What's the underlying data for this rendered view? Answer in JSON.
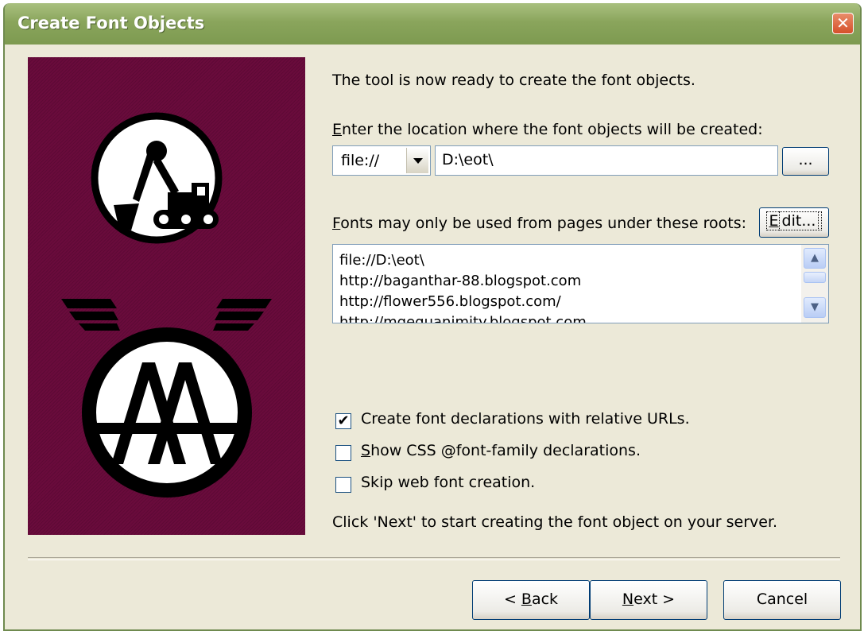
{
  "window": {
    "title": "Create Font Objects",
    "close_glyph": "✕"
  },
  "intro_text": "The tool is now ready to create the font objects.",
  "location": {
    "label_prefix": "E",
    "label_rest": "nter the location where the font objects will be created:",
    "protocol_value": "file://",
    "path_value": "D:\\eot\\",
    "browse_label": "..."
  },
  "roots": {
    "label_prefix": "F",
    "label_rest": "onts may only be used from pages under these roots:",
    "edit_prefix": "E",
    "edit_rest": "dit...",
    "items": [
      "file://D:\\eot\\",
      "http://baganthar-88.blogspot.com",
      "http://flower556.blogspot.com/",
      "http://mgequanimity.blogspot.com"
    ]
  },
  "options": [
    {
      "label": "Create font declarations with relative URLs.",
      "checked": true
    },
    {
      "label_prefix": "S",
      "label_rest": "how CSS @font-family declarations.",
      "checked": false
    },
    {
      "label": "Skip web font creation.",
      "checked": false
    }
  ],
  "hint_text": "Click 'Next' to start creating the font object on your server.",
  "buttons": {
    "back_prefix": "< ",
    "back_underlined": "B",
    "back_rest": "ack",
    "next_underlined": "N",
    "next_rest": "ext >",
    "cancel": "Cancel"
  },
  "colors": {
    "art_background": "#6a0b3c",
    "titlebar": "#8aa55c",
    "dialog_face": "#ece9d8"
  },
  "icons": {
    "top_logo": "excavator-icon",
    "bottom_logo": "winged-aa-logo"
  }
}
